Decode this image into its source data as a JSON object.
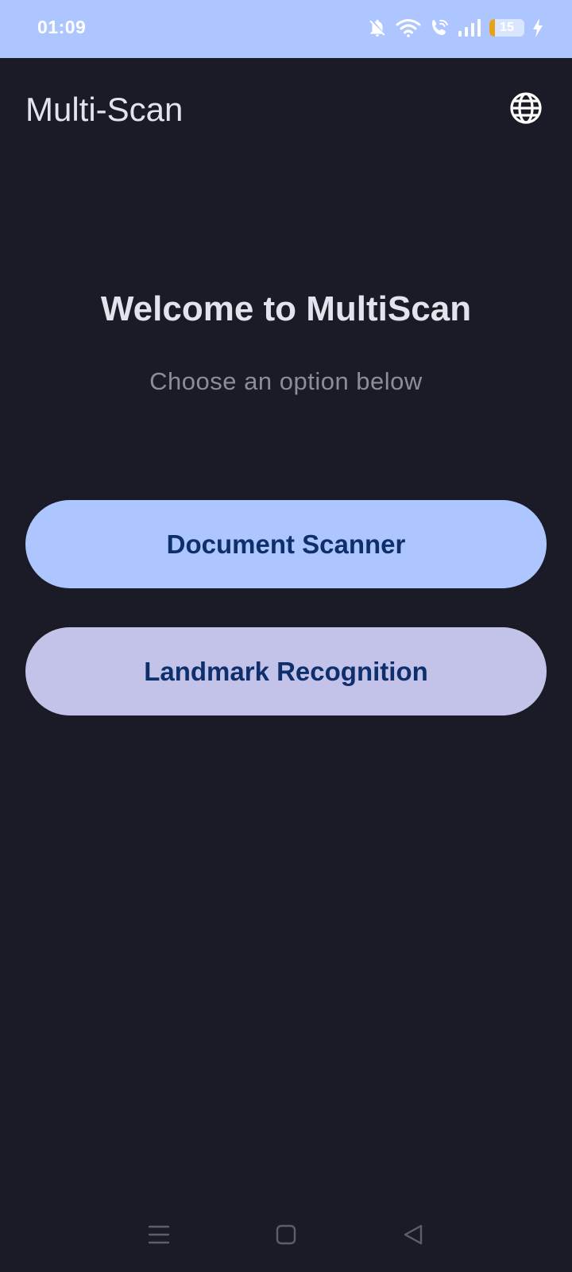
{
  "status_bar": {
    "time": "01:09",
    "battery_level": "15",
    "icons": [
      "bell-muted-icon",
      "wifi-icon",
      "wifi-call-icon",
      "signal-icon",
      "battery-icon",
      "charging-icon"
    ]
  },
  "app_bar": {
    "title": "Multi-Scan",
    "action_icon": "globe-icon"
  },
  "main": {
    "title": "Welcome to MultiScan",
    "subtitle": "Choose an option below",
    "options": [
      {
        "label": "Document Scanner",
        "color": "#adc6ff"
      },
      {
        "label": "Landmark Recognition",
        "color": "#c3c3ea"
      }
    ]
  },
  "nav_bar": {
    "icons": [
      "menu-icon",
      "home-icon",
      "back-icon"
    ]
  },
  "colors": {
    "background": "#1a1b26",
    "status_bar": "#adc6ff",
    "button_text": "#0e2f6b",
    "title_text": "#e3e3ec",
    "subtitle_text": "#8c8d96"
  }
}
